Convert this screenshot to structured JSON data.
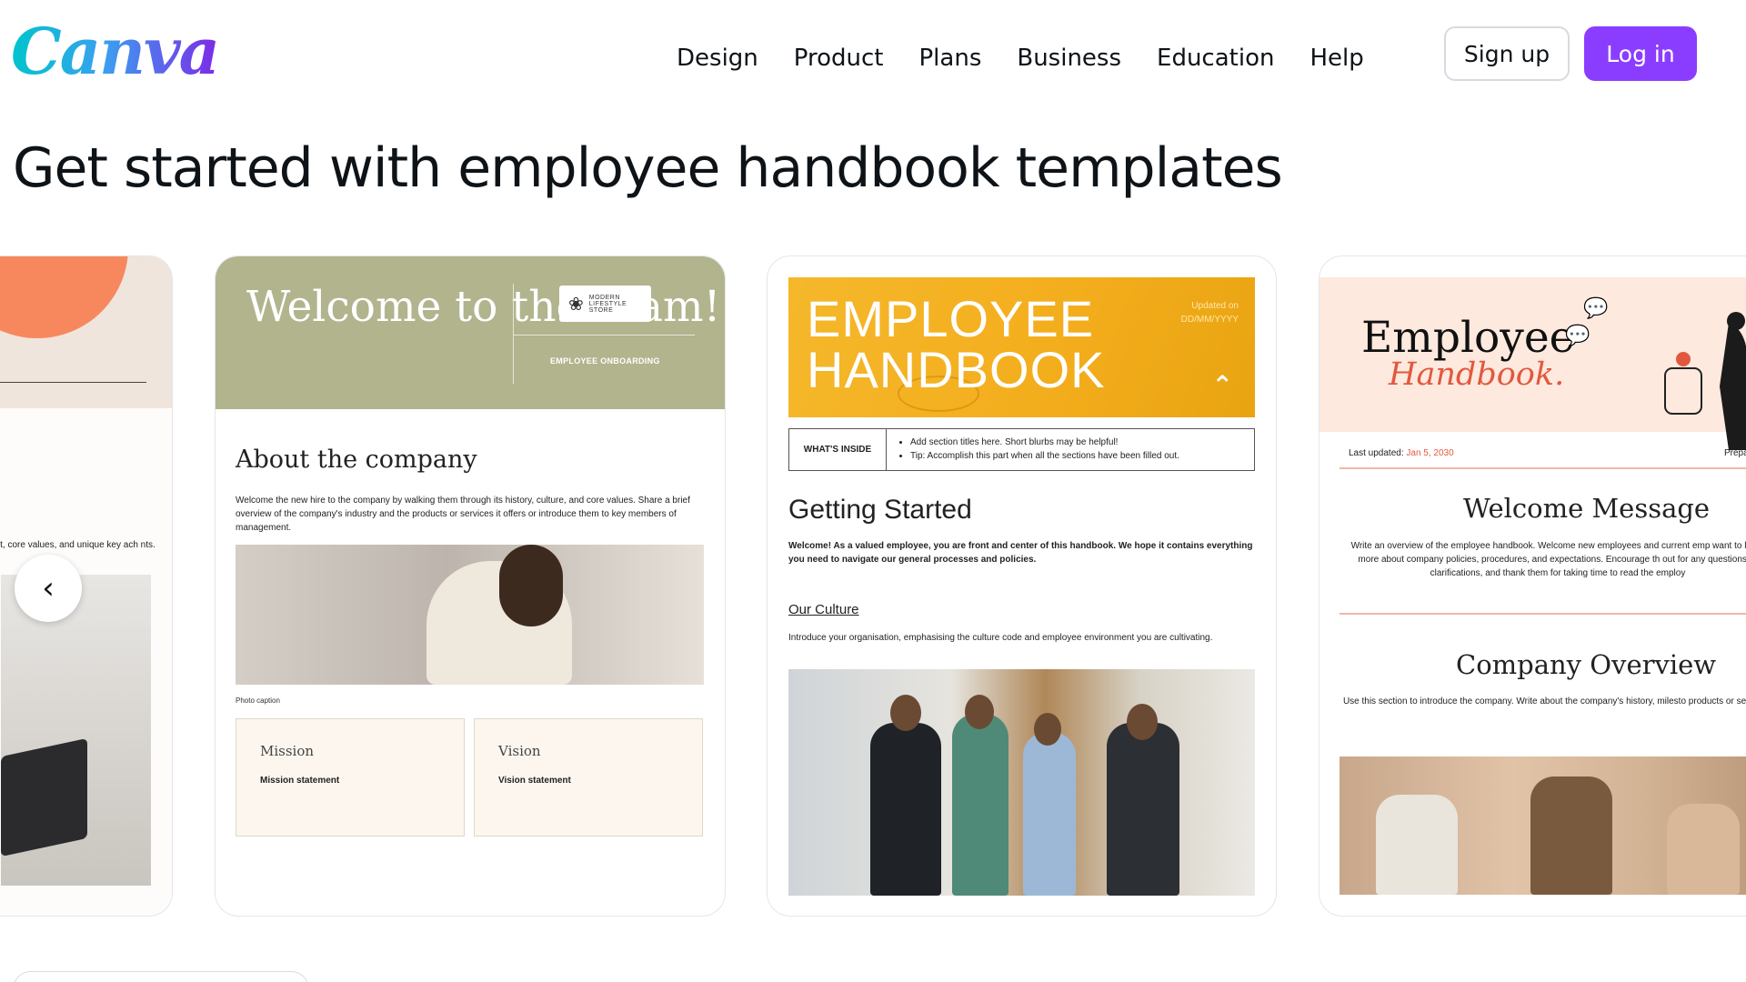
{
  "header": {
    "logo": "Canva",
    "nav": [
      "Design",
      "Product",
      "Plans",
      "Business",
      "Education",
      "Help"
    ],
    "signup_label": "Sign up",
    "login_label": "Log in"
  },
  "page_title": "Get started with employee handbook templates",
  "carousel": {
    "prev_icon": "chevron-left-icon",
    "cards": [
      {
        "partial_text": "ent, core values, and unique key ach  nts."
      },
      {
        "welcome": "Welcome to the team!",
        "brand": "MODERN LIFESTYLE STORE",
        "tag": "EMPLOYEE ONBOARDING",
        "section_title": "About the company",
        "section_text": "Welcome the new hire to the company by walking them through its history, culture, and core values. Share a brief overview of the company's industry and the products or services it offers or introduce them to key members of management.",
        "caption": "Photo caption",
        "mission_title": "Mission",
        "mission_text": "Mission statement",
        "vision_title": "Vision",
        "vision_text": "Vision statement"
      },
      {
        "title": "EMPLOYEE HANDBOOK",
        "updated": "Updated on DD/MM/YYYY",
        "whats_inside": "WHAT'S INSIDE",
        "bullets": [
          "Add section titles here. Short blurbs may be helpful!",
          "Tip: Accomplish this part when all the sections have been filled out."
        ],
        "section_title": "Getting Started",
        "section_text": "Welcome! As a valued employee, you are front and center of this handbook. We hope it contains everything you need to navigate our general processes and policies.",
        "culture_title": "Our Culture",
        "culture_text": "Introduce your organisation, emphasising the culture code and employee environment you are cultivating."
      },
      {
        "title1": "Employee",
        "title2": "Handbook.",
        "last_updated_label": "Last updated:",
        "last_updated_date": "Jan 5, 2030",
        "prepared": "Prepared",
        "welcome_title": "Welcome Message",
        "welcome_text": "Write an overview of the employee handbook. Welcome new employees and current emp want to learn more about company policies, procedures, and expectations. Encourage th out for any questions or clarifications, and thank them for taking time to read the employ",
        "overview_title": "Company Overview",
        "overview_text": "Use this section to introduce the company. Write about the company's history, milesto products or services."
      }
    ]
  },
  "colors": {
    "brand_purple": "#8b3dff",
    "sage": "#b1b48d",
    "yellow": "#f5b82b",
    "peach": "#fde9de",
    "coral": "#e2583e"
  }
}
